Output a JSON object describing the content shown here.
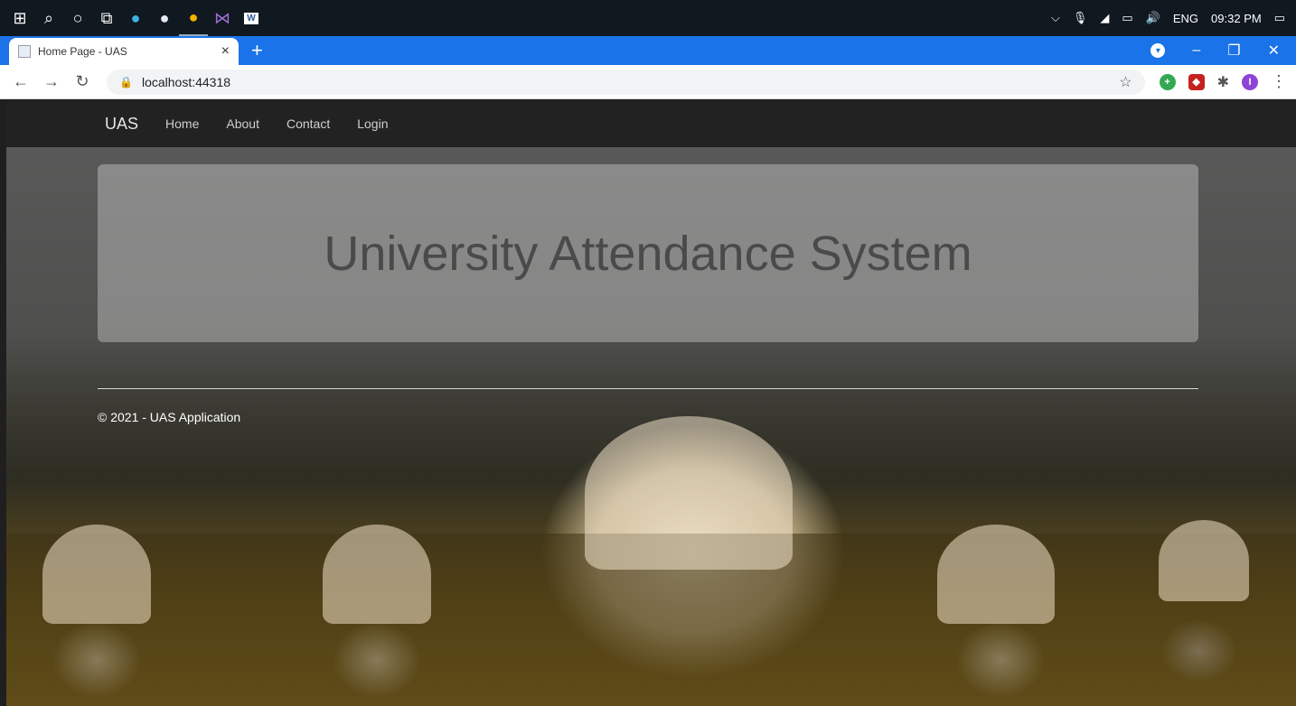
{
  "taskbar": {
    "icons": [
      "windows-icon",
      "search-icon",
      "cortana-icon",
      "task-view-icon",
      "edge-icon",
      "app-icon",
      "chrome-icon",
      "visual-studio-icon",
      "word-icon"
    ],
    "language": "ENG",
    "time": "09:32 PM"
  },
  "browser": {
    "tab_title": "Home Page - UAS",
    "url": "localhost:44318",
    "profile_initial": "I"
  },
  "site": {
    "brand": "UAS",
    "nav": [
      "Home",
      "About",
      "Contact",
      "Login"
    ],
    "heading": "University Attendance System",
    "footer": "© 2021 - UAS Application"
  }
}
